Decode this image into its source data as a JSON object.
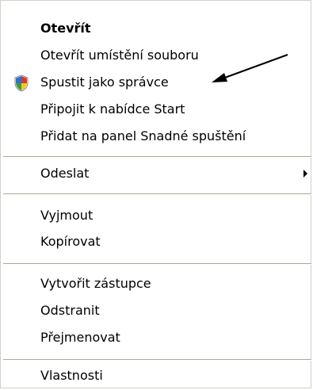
{
  "context_menu": {
    "items": [
      {
        "label": "Otevřít",
        "bold": true
      },
      {
        "label": "Otevřít umístění souboru"
      },
      {
        "label": "Spustit jako správce",
        "icon": "uac-shield-icon"
      },
      {
        "label": "Připojit k nabídce Start"
      },
      {
        "label": "Přidat na panel Snadné spuštění"
      },
      {
        "label": "Odeslat",
        "has_submenu": true
      },
      {
        "label": "Vyjmout"
      },
      {
        "label": "Kopírovat"
      },
      {
        "label": "Vytvořit zástupce"
      },
      {
        "label": "Odstranit"
      },
      {
        "label": "Přejmenovat"
      },
      {
        "label": "Vlastnosti"
      }
    ]
  },
  "colors": {
    "background": "#ffffff",
    "separator": "#aca899",
    "border": "#d4d0c8",
    "shield_blue": "#2f6fd0",
    "shield_yellow": "#f3c623",
    "shield_red": "#d63a2a",
    "shield_green": "#3e9b3a"
  },
  "annotation": {
    "icon": "pointer-arrow-icon",
    "points_to": "Spustit jako správce"
  }
}
